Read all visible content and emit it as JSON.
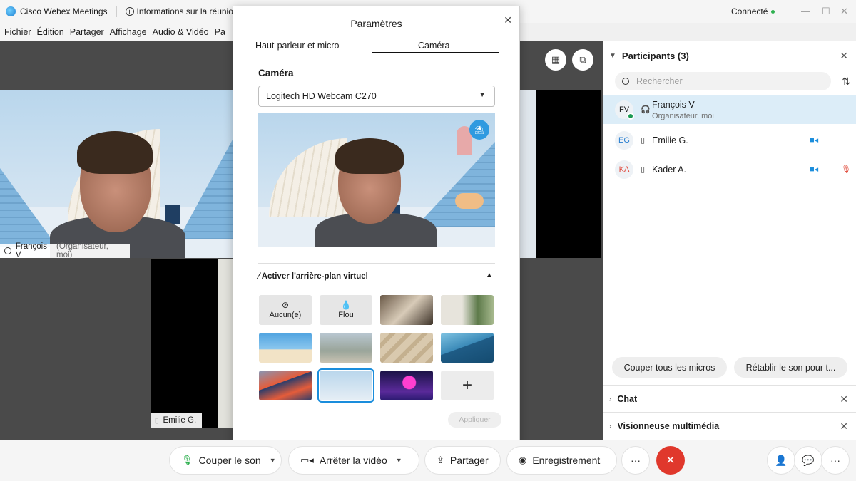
{
  "titlebar": {
    "app_title": "Cisco Webex Meetings",
    "meeting_info": "Informations sur la réunion",
    "status": "Connecté",
    "min": "—",
    "max": "☐",
    "close": "✕"
  },
  "menu": {
    "fichier": "Fichier",
    "edition": "Édition",
    "partager": "Partager",
    "affichage": "Affichage",
    "audio_video": "Audio & Vidéo",
    "p": "Pa"
  },
  "stage": {
    "main_tile": {
      "name": "François V",
      "role": "(Organisateur, moi)"
    },
    "second_tile": {
      "name": "Emilie G."
    },
    "grid_icon": "grid-icon",
    "layout_icon": "layout-icon"
  },
  "participants": {
    "header": "Participants (3)",
    "search_placeholder": "Rechercher",
    "list": [
      {
        "initials": "FV",
        "name": "François V",
        "sub": "Organisateur, moi",
        "selected": true
      },
      {
        "initials": "EG",
        "name": "Emilie G.",
        "sub": ""
      },
      {
        "initials": "KA",
        "name": "Kader A.",
        "sub": ""
      }
    ],
    "mute_all": "Couper tous les micros",
    "unmute_all": "Rétablir le son pour t..."
  },
  "sections": {
    "chat": "Chat",
    "media_viewer": "Visionneuse multimédia"
  },
  "settings": {
    "title": "Paramètres",
    "tab_audio": "Haut-parleur et micro",
    "tab_camera": "Caméra",
    "camera_label": "Caméra",
    "camera_device": "Logitech HD Webcam C270",
    "vbg_label": "Activer l'arrière-plan virtuel",
    "none_label": "Aucun(e)",
    "blur_label": "Flou",
    "add_label": "+",
    "apply_label": "Appliquer"
  },
  "controls": {
    "mute": "Couper le son",
    "stop_video": "Arrêter la vidéo",
    "share": "Partager",
    "record": "Enregistrement",
    "more": "···",
    "leave": "✕",
    "more_right": "···"
  },
  "colors": {
    "accent": "#1a8ddc",
    "leave": "#e0382c",
    "selected_row": "#dcedf8"
  }
}
